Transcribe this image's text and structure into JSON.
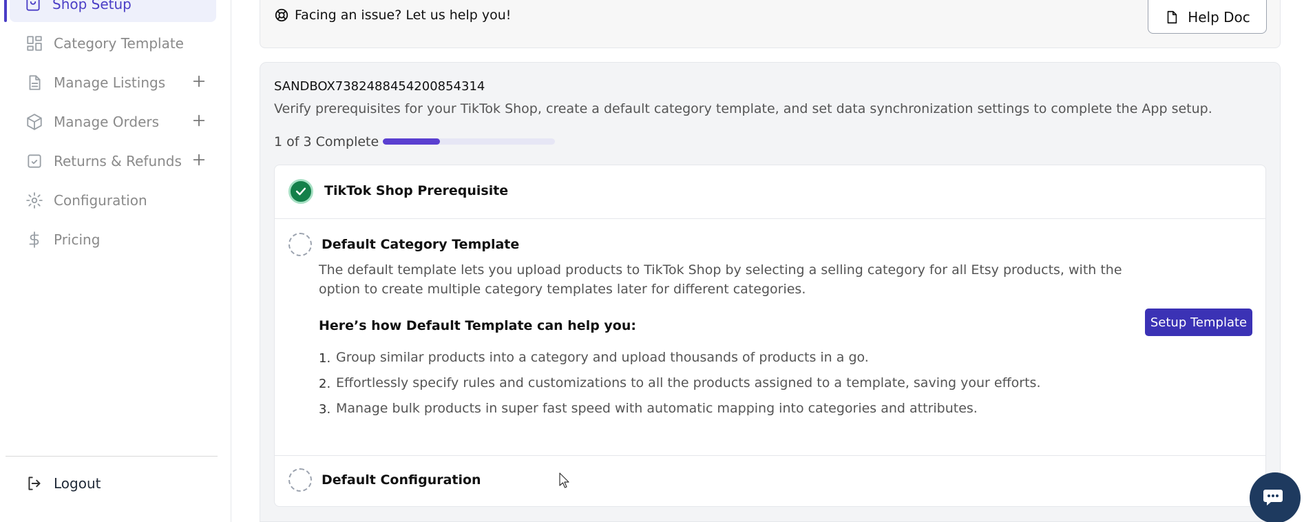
{
  "sidebar": {
    "items": [
      {
        "label": "Shop Setup",
        "icon": "shop-icon",
        "active": true
      },
      {
        "label": "Category Template",
        "icon": "template-icon"
      },
      {
        "label": "Manage Listings",
        "icon": "listings-icon",
        "expandable": true
      },
      {
        "label": "Manage Orders",
        "icon": "orders-icon",
        "expandable": true
      },
      {
        "label": "Returns & Refunds",
        "icon": "returns-icon",
        "expandable": true
      },
      {
        "label": "Configuration",
        "icon": "gear-icon"
      },
      {
        "label": "Pricing",
        "icon": "dollar-icon"
      }
    ],
    "logout_label": "Logout"
  },
  "help": {
    "text": "Facing an issue? Let us help you!",
    "button_label": "Help Doc"
  },
  "setup": {
    "shop_id": "SANDBOX7382488454200854314",
    "description": "Verify prerequisites for your TikTok Shop, create a default category template, and set data synchronization settings to complete the App setup.",
    "progress_label": "1 of 3 Complete",
    "progress_fraction": 0.333,
    "steps": [
      {
        "title": "TikTok Shop Prerequisite",
        "status": "complete"
      },
      {
        "title": "Default Category Template",
        "status": "pending",
        "description": "The default template lets you upload products to TikTok Shop by selecting a selling category for all Etsy products, with the option to create multiple category templates later for different categories.",
        "button_label": "Setup Template",
        "help_heading": "Here’s how Default Template can help you:",
        "benefits": [
          {
            "num": "1.",
            "text": "Group similar products into a category and upload thousands of products in a go."
          },
          {
            "num": "2.",
            "text": "Effortlessly specify rules and customizations to all the products assigned to a template, saving your efforts."
          },
          {
            "num": "3.",
            "text": "Manage bulk products in super fast speed with automatic mapping into categories and attributes."
          }
        ]
      },
      {
        "title": "Default Configuration",
        "status": "pending"
      }
    ]
  },
  "colors": {
    "accent": "#4b3ec6",
    "button": "#3b32b5",
    "success": "#14804a",
    "chat": "#1e3a5f"
  }
}
